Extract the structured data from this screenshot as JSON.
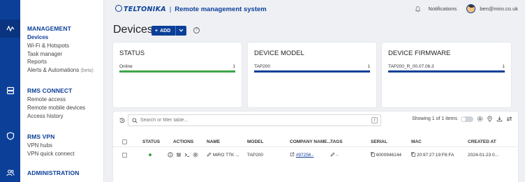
{
  "colors": {
    "brand": "#0c3f98",
    "online": "#3ea64a"
  },
  "rail": {
    "items": [
      "activity-icon",
      "servers-icon",
      "shield-icon",
      "users-icon"
    ]
  },
  "sidebar": {
    "sections": [
      {
        "title": "MANAGEMENT",
        "items": [
          "Devices",
          "Wi-Fi & Hotspots",
          "Task manager",
          "Reports",
          "Alerts & Automations"
        ],
        "active": "Devices",
        "beta": "(beta)"
      },
      {
        "title": "RMS CONNECT",
        "items": [
          "Remote access",
          "Remote mobile devices",
          "Access history"
        ]
      },
      {
        "title": "RMS VPN",
        "items": [
          "VPN hubs",
          "VPN quick connect"
        ]
      },
      {
        "title": "ADMINISTRATION",
        "items": []
      }
    ]
  },
  "header": {
    "logo": "TELTONIKA",
    "separator": "|",
    "title": "Remote management system",
    "notifications": "Notifications",
    "user_email": "ben@miro.co.uk"
  },
  "page": {
    "title": "Devices",
    "add_label": "ADD",
    "help": "?"
  },
  "cards": [
    {
      "title": "STATUS",
      "label": "Online",
      "count": "1"
    },
    {
      "title": "DEVICE MODEL",
      "label": "TAP200",
      "count": "1"
    },
    {
      "title": "DEVICE FIRMWARE",
      "label": "TAP200_R_00.07.06.3",
      "count": "1"
    }
  ],
  "table": {
    "search_placeholder": "Search or filter table...",
    "search_key": "/",
    "showing": "Showing 1 of 1 items",
    "columns": [
      "STATUS",
      "ACTIONS",
      "NAME",
      "MODEL",
      "COMPANY NAME...",
      "TAGS",
      "SERIAL",
      "MAC",
      "CREATED AT"
    ],
    "rows": [
      {
        "name": "MiRO TTK ...",
        "model": "TAP200",
        "company": "#97256 -",
        "tags": "-",
        "serial": "6000946144",
        "mac": "20:97:27:19:F8:FA",
        "created": "2024-01-23 0..."
      }
    ]
  }
}
